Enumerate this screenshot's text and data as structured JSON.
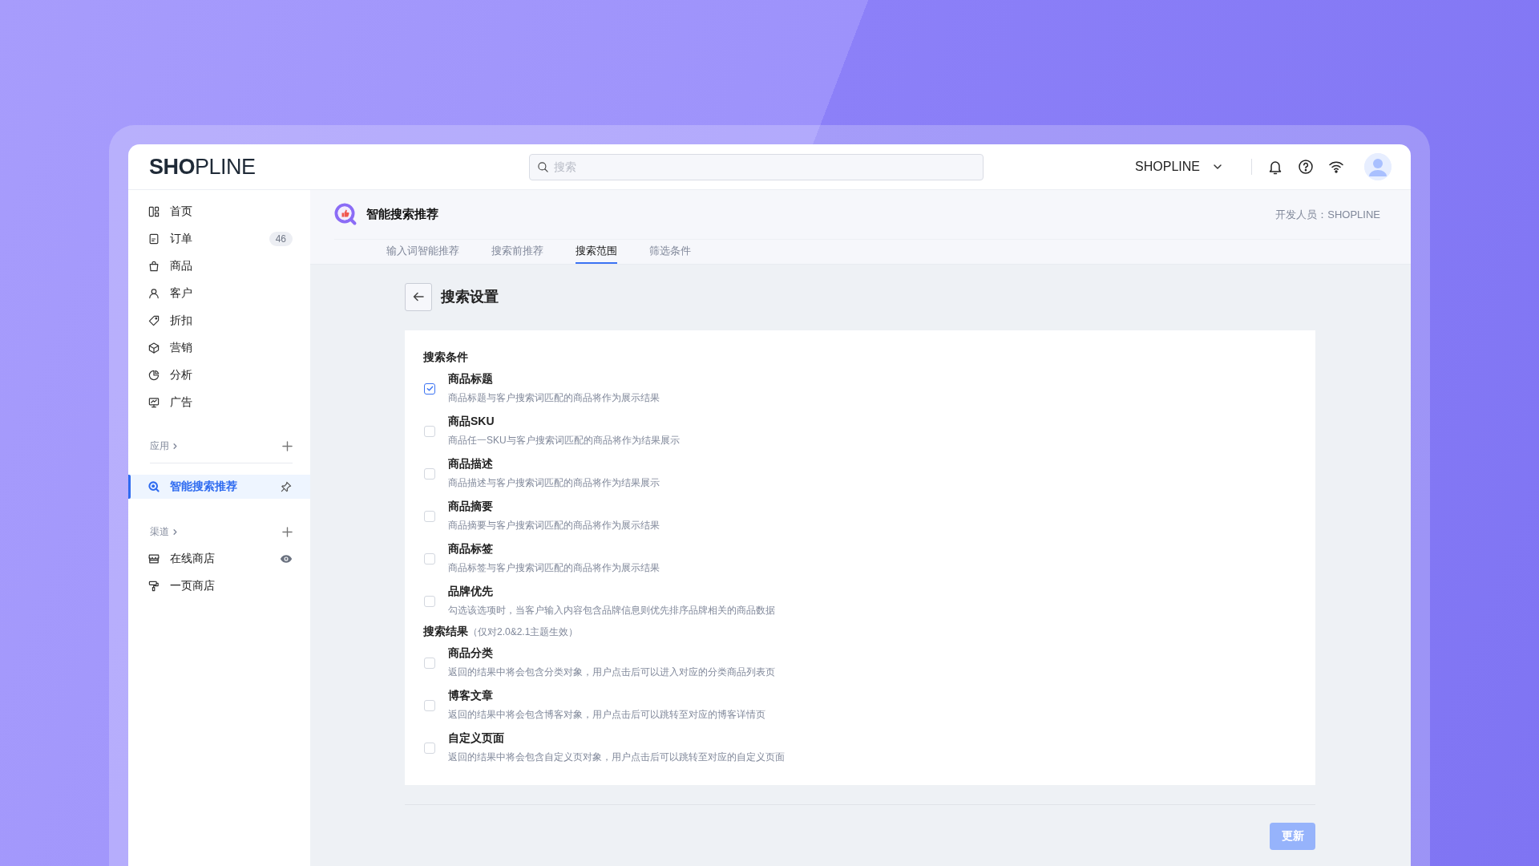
{
  "topbar": {
    "logo": "**SHO**PLINE",
    "search": {
      "placeholder": "搜索"
    },
    "store_name": "SHOPLINE"
  },
  "sidebar": {
    "items": [
      {
        "label": "首页",
        "kind": "home",
        "selected": false
      },
      {
        "label": "订单",
        "kind": "orders",
        "badge": "46",
        "selected": false
      },
      {
        "label": "商品",
        "kind": "products",
        "selected": false
      },
      {
        "label": "客户",
        "kind": "customers",
        "selected": false
      },
      {
        "label": "折扣",
        "kind": "discounts",
        "selected": false
      },
      {
        "label": "营销",
        "kind": "marketing",
        "selected": false
      },
      {
        "label": "分析",
        "kind": "analytics",
        "selected": false
      },
      {
        "label": "广告",
        "kind": "ads",
        "selected": false
      }
    ],
    "groups": [
      {
        "label": "应用",
        "items": [
          {
            "label": "智能搜索推荐",
            "kind": "search-app",
            "selected": true,
            "pinned": true
          }
        ]
      },
      {
        "label": "渠道",
        "items": [
          {
            "label": "在线商店",
            "kind": "store",
            "selected": false,
            "previewable": true
          },
          {
            "label": "一页商店",
            "kind": "one-page",
            "selected": false
          }
        ]
      }
    ]
  },
  "page": {
    "title": "智能搜索推荐",
    "developer": "开发人员：SHOPLINE",
    "tabs": [
      {
        "label": "输入词智能推荐",
        "selected": false
      },
      {
        "label": "搜索前推荐",
        "selected": false
      },
      {
        "label": "搜索范围",
        "selected": true
      },
      {
        "label": "筛选条件",
        "selected": false
      }
    ],
    "heading": "搜索设置",
    "sections": [
      {
        "title": "搜索条件",
        "options": [
          {
            "label": "商品标题",
            "description": "商品标题与客户搜索词匹配的商品将作为展示结果",
            "checked": true
          },
          {
            "label": "商品SKU",
            "description": "商品任一SKU与客户搜索词匹配的商品将作为结果展示",
            "checked": false
          },
          {
            "label": "商品描述",
            "description": "商品描述与客户搜索词匹配的商品将作为结果展示",
            "checked": false
          },
          {
            "label": "商品摘要",
            "description": "商品摘要与客户搜索词匹配的商品将作为展示结果",
            "checked": false
          },
          {
            "label": "商品标签",
            "description": "商品标签与客户搜索词匹配的商品将作为展示结果",
            "checked": false
          },
          {
            "label": "品牌优先",
            "description": "勾选该选项时，当客户输入内容包含品牌信息则优先排序品牌相关的商品数据",
            "checked": false
          }
        ]
      },
      {
        "title": "搜索结果",
        "note": "（仅对2.0&2.1主题生效）",
        "options": [
          {
            "label": "商品分类",
            "description": "返回的结果中将会包含分类对象，用户点击后可以进入对应的分类商品列表页",
            "checked": false
          },
          {
            "label": "博客文章",
            "description": "返回的结果中将会包含博客对象，用户点击后可以跳转至对应的博客详情页",
            "checked": false
          },
          {
            "label": "自定义页面",
            "description": "返回的结果中将会包含自定义页对象，用户点击后可以跳转至对应的自定义页面",
            "checked": false
          }
        ]
      }
    ],
    "update_button": {
      "label": "更新",
      "disabled": true
    }
  }
}
